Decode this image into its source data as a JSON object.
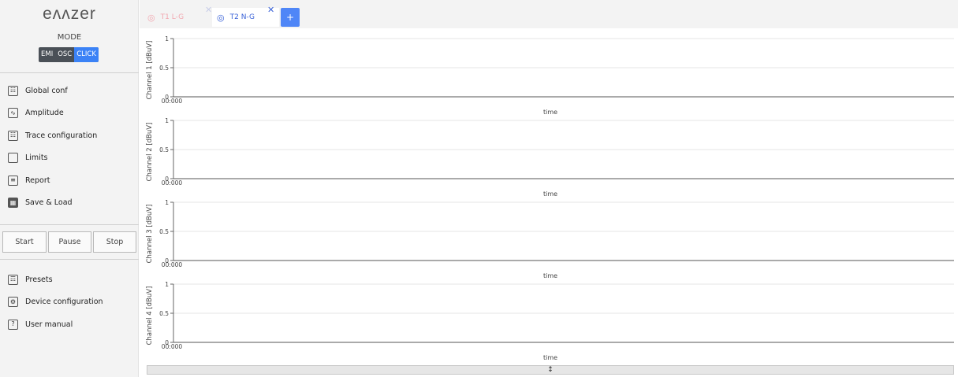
{
  "sidebar": {
    "logo": "eʌʌzer",
    "mode_label": "MODE",
    "modes": [
      {
        "label": "EMI",
        "active": false
      },
      {
        "label": "OSC",
        "active": false
      },
      {
        "label": "CLICK",
        "active": true
      }
    ],
    "menu_top": [
      {
        "label": "Global conf",
        "icon": "global-conf-icon"
      },
      {
        "label": "Amplitude",
        "icon": "amplitude-icon"
      },
      {
        "label": "Trace configuration",
        "icon": "trace-config-icon"
      },
      {
        "label": "Limits",
        "icon": "limits-icon"
      },
      {
        "label": "Report",
        "icon": "report-icon"
      },
      {
        "label": "Save & Load",
        "icon": "save-load-icon"
      }
    ],
    "controls": {
      "start": "Start",
      "pause": "Pause",
      "stop": "Stop"
    },
    "menu_bottom": [
      {
        "label": "Presets",
        "icon": "presets-icon"
      },
      {
        "label": "Device configuration",
        "icon": "device-config-icon"
      },
      {
        "label": "User manual",
        "icon": "user-manual-icon"
      }
    ]
  },
  "tabs": [
    {
      "label": "T1 L-G",
      "active": false,
      "color": "#f2a8b0"
    },
    {
      "label": "T2 N-G",
      "active": true,
      "color": "#3b63d8"
    }
  ],
  "add_tab_label": "+",
  "colors": {
    "accent": "#3b82f6",
    "mode_bg": "#4a5057"
  },
  "chart_data": [
    {
      "type": "line",
      "ylabel": "Channel 1 [dBuV]",
      "xlabel": "time",
      "yticks": [
        "1",
        "0.5",
        "0"
      ],
      "xtick": "00:000",
      "ylim": [
        0,
        1
      ],
      "series": [],
      "grid": true
    },
    {
      "type": "line",
      "ylabel": "Channel 2 [dBuV]",
      "xlabel": "time",
      "yticks": [
        "1",
        "0.5",
        "0"
      ],
      "xtick": "00:000",
      "ylim": [
        0,
        1
      ],
      "series": [],
      "grid": true
    },
    {
      "type": "line",
      "ylabel": "Channel 3 [dBuV]",
      "xlabel": "time",
      "yticks": [
        "1",
        "0.5",
        "0"
      ],
      "xtick": "00:000",
      "ylim": [
        0,
        1
      ],
      "series": [],
      "grid": true
    },
    {
      "type": "line",
      "ylabel": "Channel 4 [dBuV]",
      "xlabel": "time",
      "yticks": [
        "1",
        "0.5",
        "0"
      ],
      "xtick": "00:000",
      "ylim": [
        0,
        1
      ],
      "series": [],
      "grid": true
    }
  ],
  "splitter_icon": "↕"
}
